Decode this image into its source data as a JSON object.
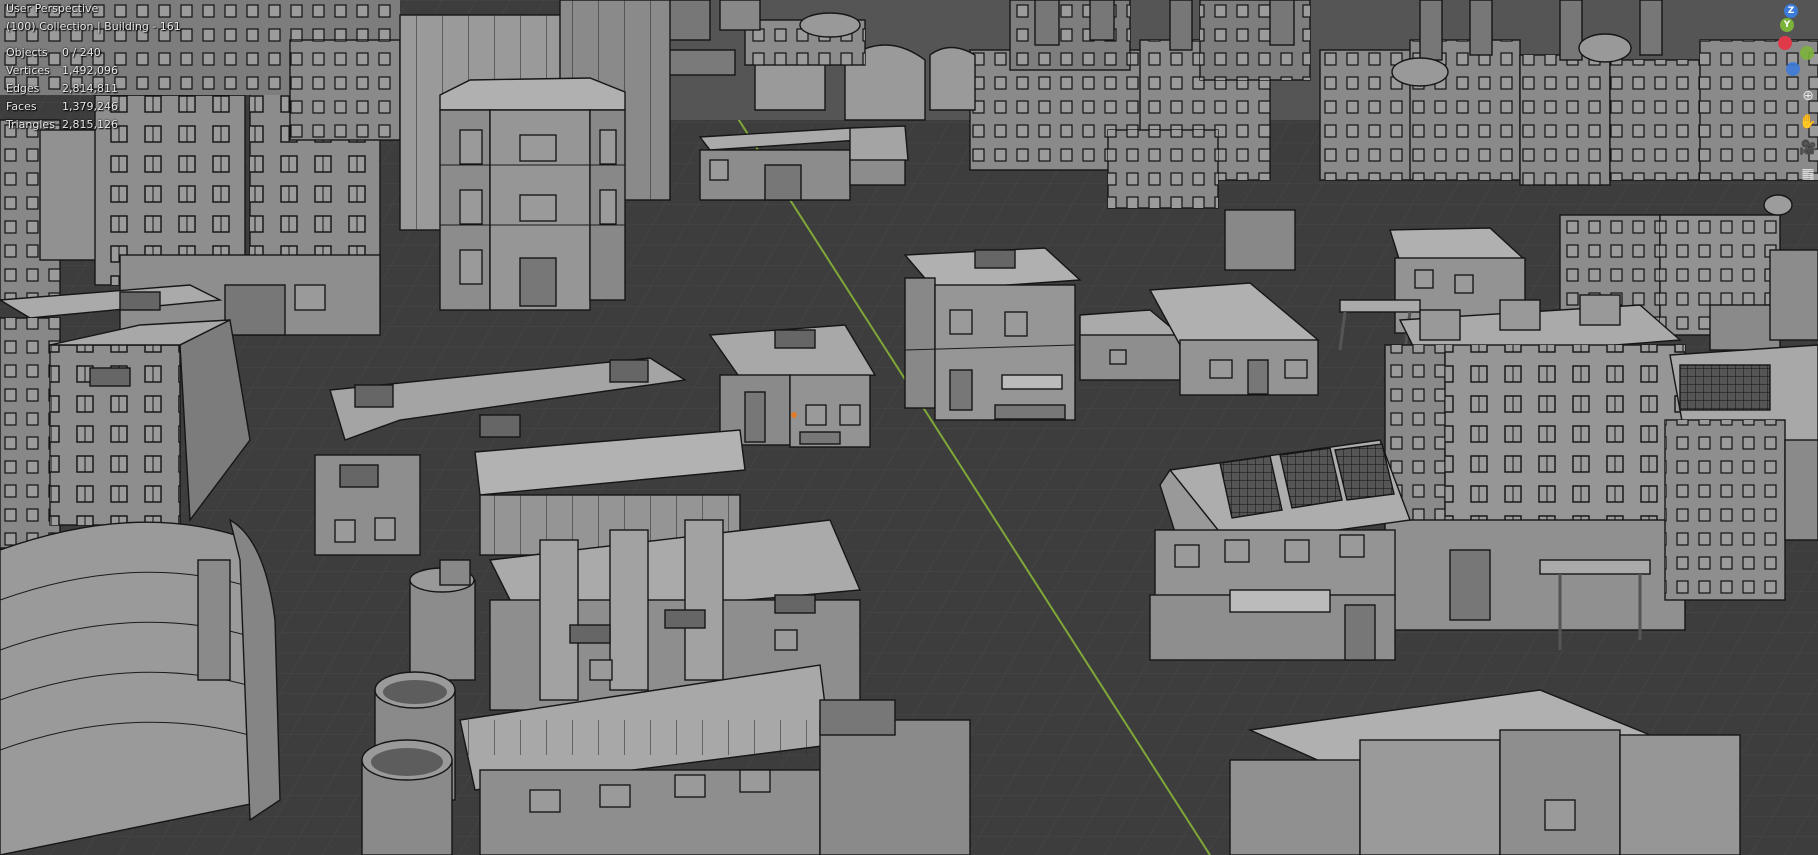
{
  "viewport": {
    "mode": "User Perspective",
    "collection": "(100) Collection | Building - 161"
  },
  "stats": [
    {
      "label": "Objects",
      "value": "0 / 240"
    },
    {
      "label": "Vertices",
      "value": "1,492,096"
    },
    {
      "label": "Edges",
      "value": "2,814,811"
    },
    {
      "label": "Faces",
      "value": "1,379,246"
    },
    {
      "label": "Triangles",
      "value": "2,815,126"
    }
  ],
  "gizmo": {
    "z": "Z",
    "y": "Y",
    "x_color": "#e0394a",
    "y_color": "#7bb23a",
    "z_color": "#3d7bd9"
  },
  "nav_tools": [
    {
      "name": "zoom-icon",
      "glyph": "⊕"
    },
    {
      "name": "pan-icon",
      "glyph": "✋"
    },
    {
      "name": "camera-icon",
      "glyph": "🎥"
    },
    {
      "name": "grid-icon",
      "glyph": "▦"
    }
  ],
  "colors": {
    "background": "#3d3d3d",
    "grid": "#4a4a4a",
    "axis_line": "#7fa838",
    "building": "#8c8c8c"
  }
}
